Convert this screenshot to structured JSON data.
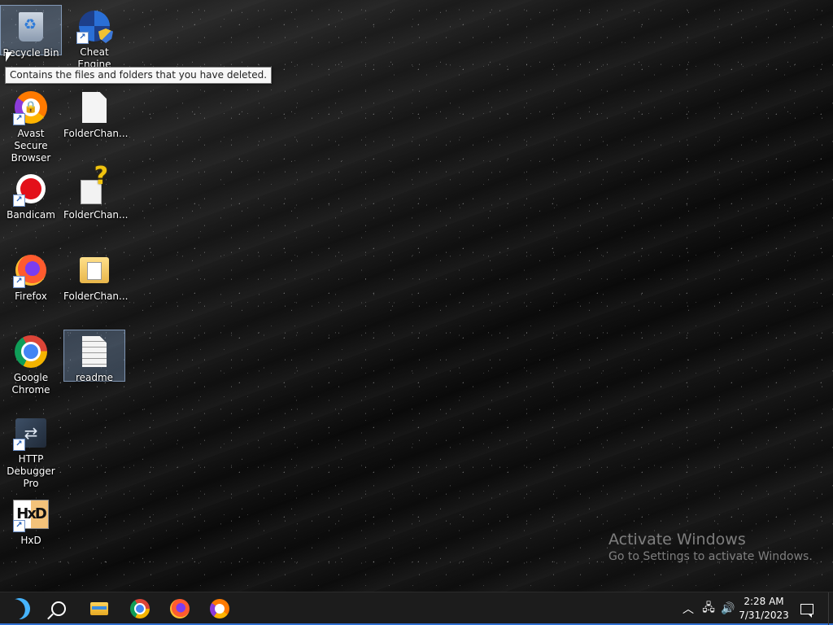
{
  "desktop": {
    "icons": [
      {
        "label": "Recycle Bin",
        "icon": "recycle-bin-icon"
      },
      {
        "label": "Cheat Engine",
        "icon": "cheat-engine-icon"
      },
      {
        "label": "Avast Secure Browser",
        "icon": "avast-browser-icon"
      },
      {
        "label": "FolderChan...",
        "icon": "text-file-icon"
      },
      {
        "label": "Bandicam",
        "icon": "bandicam-icon"
      },
      {
        "label": "FolderChan...",
        "icon": "unknown-file-icon"
      },
      {
        "label": "Firefox",
        "icon": "firefox-icon"
      },
      {
        "label": "FolderChan...",
        "icon": "folder-file-icon"
      },
      {
        "label": "Google Chrome",
        "icon": "chrome-icon"
      },
      {
        "label": "readme",
        "icon": "text-file-icon"
      },
      {
        "label": "HTTP Debugger Pro",
        "icon": "http-debugger-icon"
      },
      {
        "label": "HxD",
        "icon": "hxd-icon"
      }
    ],
    "tooltip": "Contains the files and folders that you have deleted."
  },
  "watermark": {
    "title": "Activate Windows",
    "subtitle": "Go to Settings to activate Windows."
  },
  "taskbar": {
    "pinned": [
      "start-icon",
      "search-icon",
      "file-explorer-icon",
      "chrome-icon",
      "firefox-icon",
      "avast-browser-icon"
    ],
    "tray": [
      "chevron-up-icon",
      "network-icon",
      "volume-icon"
    ],
    "clock": {
      "time": "2:28 AM",
      "date": "7/31/2023"
    }
  },
  "colors": {
    "accent": "#2f6fd0",
    "taskbar": "#1c1c1c",
    "start": "#46b4ff"
  }
}
